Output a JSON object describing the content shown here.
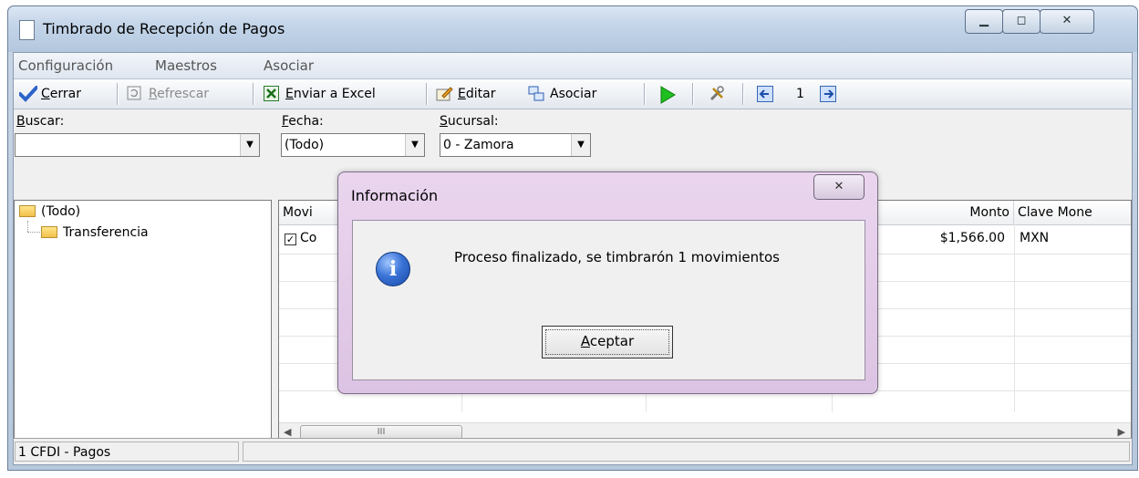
{
  "window": {
    "title": "Timbrado de Recepción de Pagos"
  },
  "menu": [
    "Configuración",
    "Maestros",
    "Asociar"
  ],
  "toolbar": {
    "cerrar_pre": "",
    "cerrar_ul": "C",
    "cerrar_rest": "errar",
    "refrescar_ul": "R",
    "refrescar_rest": "efrescar",
    "excel_ul": "E",
    "excel_rest": "nviar a Excel",
    "editar_ul": "E",
    "editar_rest": "ditar",
    "asociar": "Asociar",
    "page_number": "1"
  },
  "filters": {
    "buscar_ul": "B",
    "buscar_rest": "uscar:",
    "fecha_ul": "F",
    "fecha_rest": "echa:",
    "fecha_value": "(Todo)",
    "sucursal_ul": "S",
    "sucursal_rest": "ucursal:",
    "sucursal_value": "0 - Zamora"
  },
  "tree": {
    "root": "(Todo)",
    "child": "Transferencia"
  },
  "grid": {
    "columns": [
      "Movi",
      "Monto",
      "Clave Mone"
    ],
    "row": {
      "first_cell": "Co",
      "monto": "$1,566.00",
      "moneda": "MXN"
    }
  },
  "status": {
    "left": "1 CFDI - Pagos"
  },
  "dialog": {
    "title": "Información",
    "message": "Proceso finalizado, se timbrarón 1 movimientos",
    "accept_ul": "A",
    "accept_rest": "ceptar"
  },
  "colors": {
    "titlebar": "#c4d5e9",
    "dialog_frame": "#dcc3e3",
    "play_green": "#1fbf1f"
  }
}
